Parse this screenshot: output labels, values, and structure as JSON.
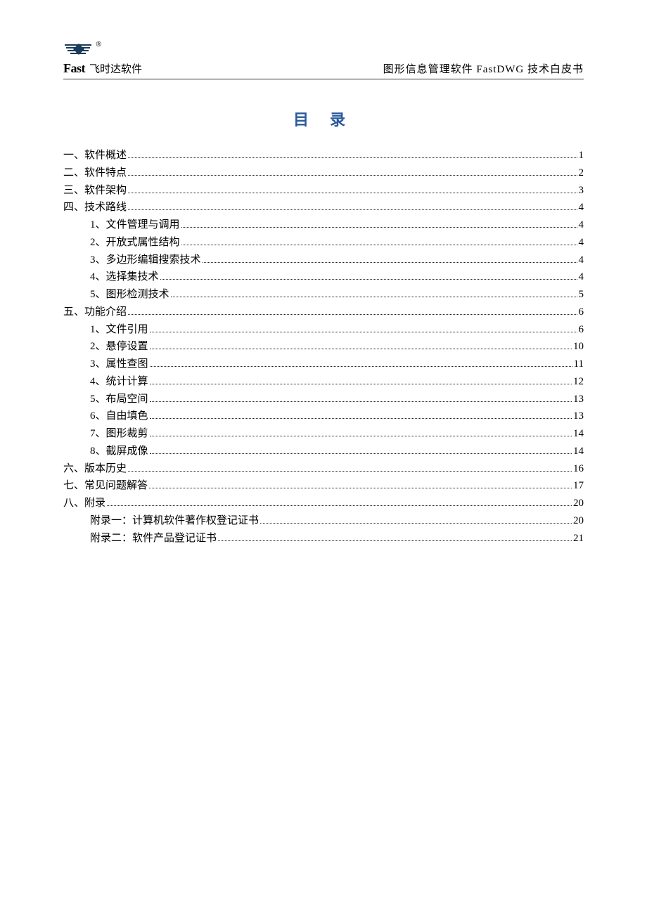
{
  "header": {
    "brand_en": "Fast",
    "brand_cn": "飞时达软件",
    "reg_symbol": "®",
    "doc_title": "图形信息管理软件 FastDWG 技术白皮书"
  },
  "toc": {
    "heading": "目 录",
    "entries": [
      {
        "level": 1,
        "label": "一、软件概述",
        "page": "1"
      },
      {
        "level": 1,
        "label": "二、软件特点",
        "page": "2"
      },
      {
        "level": 1,
        "label": "三、软件架构",
        "page": "3"
      },
      {
        "level": 1,
        "label": "四、技术路线",
        "page": "4"
      },
      {
        "level": 2,
        "label": "1、文件管理与调用",
        "page": "4"
      },
      {
        "level": 2,
        "label": "2、开放式属性结构",
        "page": "4"
      },
      {
        "level": 2,
        "label": "3、多边形编辑搜索技术",
        "page": "4"
      },
      {
        "level": 2,
        "label": "4、选择集技术",
        "page": "4"
      },
      {
        "level": 2,
        "label": "5、图形检测技术",
        "page": "5"
      },
      {
        "level": 1,
        "label": "五、功能介绍",
        "page": "6"
      },
      {
        "level": 2,
        "label": "1、文件引用",
        "page": "6"
      },
      {
        "level": 2,
        "label": "2、悬停设置",
        "page": "10"
      },
      {
        "level": 2,
        "label": "3、属性查图",
        "page": "11"
      },
      {
        "level": 2,
        "label": "4、统计计算",
        "page": "12"
      },
      {
        "level": 2,
        "label": "5、布局空间",
        "page": "13"
      },
      {
        "level": 2,
        "label": "6、自由填色",
        "page": "13"
      },
      {
        "level": 2,
        "label": "7、图形裁剪",
        "page": "14"
      },
      {
        "level": 2,
        "label": "8、截屏成像",
        "page": "14"
      },
      {
        "level": 1,
        "label": "六、版本历史",
        "page": "16"
      },
      {
        "level": 1,
        "label": "七、常见问题解答",
        "page": "17"
      },
      {
        "level": 1,
        "label": "八、附录",
        "page": "20"
      },
      {
        "level": 2,
        "label": "附录一：计算机软件著作权登记证书",
        "page": "20"
      },
      {
        "level": 2,
        "label": "附录二：软件产品登记证书",
        "page": "21"
      }
    ]
  }
}
